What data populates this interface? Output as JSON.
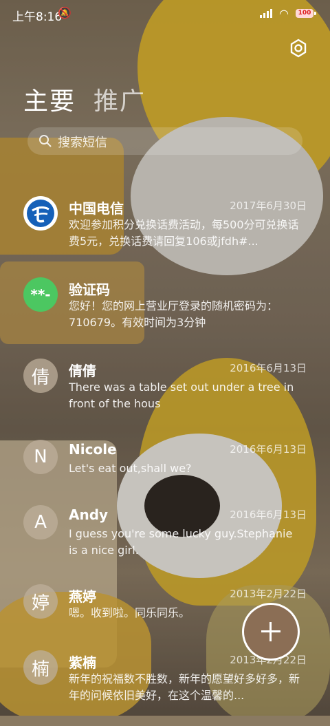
{
  "status_bar": {
    "time": "上午8:16",
    "battery": "100"
  },
  "tabs": {
    "main": "主要",
    "promo": "推广"
  },
  "search": {
    "placeholder": "搜索短信"
  },
  "colors": {
    "telecom_blue": "#1560b8",
    "code_green": "#4cc761",
    "fab": "#8b6e55"
  },
  "messages": [
    {
      "sender": "中国电信",
      "date": "2017年6月30日",
      "avatar": "telecom-logo",
      "preview": "欢迎参加积分兑换话费活动，每500分可兑换话费5元，兑换话费请回复106或jfdh#..."
    },
    {
      "sender": "验证码",
      "date": "",
      "avatar_text": "**-",
      "preview": "您好！您的网上营业厅登录的随机密码为：710679。有效时间为3分钟"
    },
    {
      "sender": "倩倩",
      "date": "2016年6月13日",
      "avatar_text": "倩",
      "preview": "There was a table set out under a tree in front of the hous"
    },
    {
      "sender": "Nicole",
      "date": "2016年6月13日",
      "avatar_text": "N",
      "preview": "Let's eat out,shall we?"
    },
    {
      "sender": "Andy",
      "date": "2016年6月13日",
      "avatar_text": "A",
      "preview": "I guess you're some lucky guy.Stephanie is a nice girl."
    },
    {
      "sender": "燕婷",
      "date": "2013年2月22日",
      "avatar_text": "婷",
      "preview": "嗯。收到啦。同乐同乐。"
    },
    {
      "sender": "紫楠",
      "date": "2013年2月22日",
      "avatar_text": "楠",
      "preview": "新年的祝福数不胜数，新年的愿望好多好多，新年的问候依旧美好，在这个温馨的..."
    }
  ]
}
